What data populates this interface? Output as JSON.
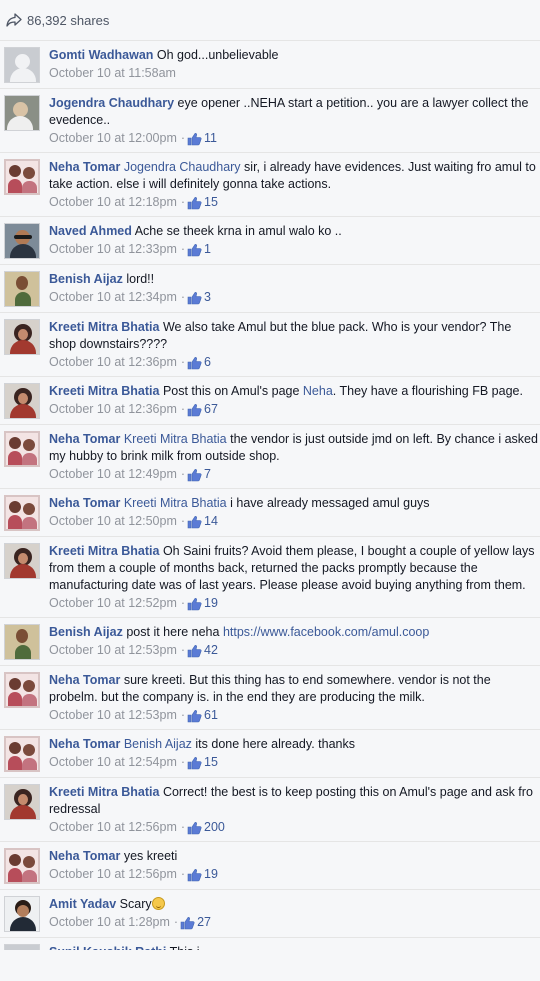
{
  "header": {
    "shares": "86,392 shares",
    "icon": "share-icon"
  },
  "comments": [
    {
      "avatar": "grey",
      "name": "Gomti Wadhawan",
      "parts": [
        {
          "t": "Oh god...unbelievable"
        }
      ],
      "time": "October 10 at 11:58am",
      "likes": null
    },
    {
      "avatar": "jog",
      "name": "Jogendra Chaudhary",
      "parts": [
        {
          "t": "eye opener ..NEHA start a petition.. you are a lawyer collect the evedence.."
        }
      ],
      "time": "October 10 at 12:00pm",
      "likes": "11"
    },
    {
      "avatar": "neha",
      "name": "Neha Tomar",
      "parts": [
        {
          "m": "Jogendra Chaudhary"
        },
        {
          "t": " sir, i already have evidences. Just waiting fro amul to take action. else i will definitely gonna take actions."
        }
      ],
      "time": "October 10 at 12:18pm",
      "likes": "15"
    },
    {
      "avatar": "naved",
      "name": "Naved Ahmed",
      "parts": [
        {
          "t": "Ache se theek krna in amul walo ko .."
        }
      ],
      "time": "October 10 at 12:33pm",
      "likes": "1"
    },
    {
      "avatar": "benish",
      "name": "Benish Aijaz",
      "parts": [
        {
          "t": "lord!!"
        }
      ],
      "time": "October 10 at 12:34pm",
      "likes": "3"
    },
    {
      "avatar": "kreeti",
      "name": "Kreeti Mitra Bhatia",
      "parts": [
        {
          "t": "We also take Amul but the blue pack. Who is your vendor? The shop downstairs????"
        }
      ],
      "time": "October 10 at 12:36pm",
      "likes": "6"
    },
    {
      "avatar": "kreeti",
      "name": "Kreeti Mitra Bhatia",
      "parts": [
        {
          "t": "Post this on Amul's page "
        },
        {
          "m": "Neha"
        },
        {
          "t": ". They have a flourishing FB page."
        }
      ],
      "time": "October 10 at 12:36pm",
      "likes": "67"
    },
    {
      "avatar": "neha",
      "name": "Neha Tomar",
      "parts": [
        {
          "m": "Kreeti Mitra Bhatia"
        },
        {
          "t": " the vendor is just outside jmd on left. By chance i asked my hubby to brink milk from outside shop."
        }
      ],
      "time": "October 10 at 12:49pm",
      "likes": "7"
    },
    {
      "avatar": "neha",
      "name": "Neha Tomar",
      "parts": [
        {
          "m": "Kreeti Mitra Bhatia"
        },
        {
          "t": " i have already messaged amul guys"
        }
      ],
      "time": "October 10 at 12:50pm",
      "likes": "14"
    },
    {
      "avatar": "kreeti",
      "name": "Kreeti Mitra Bhatia",
      "parts": [
        {
          "t": "Oh Saini fruits? Avoid them please, I bought a couple of yellow lays from them a couple of months back, returned the packs promptly because the manufacturing date was of last years. Please please avoid buying anything from them."
        }
      ],
      "time": "October 10 at 12:52pm",
      "likes": "19"
    },
    {
      "avatar": "benish",
      "name": "Benish Aijaz",
      "parts": [
        {
          "t": "post it here neha "
        },
        {
          "l": "https://www.facebook.com/amul.coop"
        }
      ],
      "time": "October 10 at 12:53pm",
      "likes": "42"
    },
    {
      "avatar": "neha",
      "name": "Neha Tomar",
      "parts": [
        {
          "t": "sure kreeti. But this thing has to end somewhere. vendor is not the probelm. but the company is. in the end they are producing the milk."
        }
      ],
      "time": "October 10 at 12:53pm",
      "likes": "61"
    },
    {
      "avatar": "neha",
      "name": "Neha Tomar",
      "parts": [
        {
          "m": "Benish Aijaz"
        },
        {
          "t": " its done here already. thanks"
        }
      ],
      "time": "October 10 at 12:54pm",
      "likes": "15"
    },
    {
      "avatar": "kreeti",
      "name": "Kreeti Mitra Bhatia",
      "parts": [
        {
          "t": "Correct! the best is to keep posting this on Amul's page and ask fro redressal"
        }
      ],
      "time": "October 10 at 12:56pm",
      "likes": "200"
    },
    {
      "avatar": "neha",
      "name": "Neha Tomar",
      "parts": [
        {
          "t": "yes kreeti"
        }
      ],
      "time": "October 10 at 12:56pm",
      "likes": "19"
    },
    {
      "avatar": "amit",
      "name": "Amit Yadav",
      "parts": [
        {
          "t": "Scary"
        },
        {
          "e": "smile-emoji"
        }
      ],
      "time": "October 10 at 1:28pm",
      "likes": "27"
    }
  ],
  "icons": {
    "like": "thumbs-up-icon",
    "share": "share-icon"
  },
  "colors": {
    "link": "#3b5998",
    "meta": "#90949c",
    "text": "#141823",
    "background": "#f6f7f9"
  },
  "footer_partial": {
    "name": "Sunil Kaushik Rathi",
    "text": "This i..."
  }
}
